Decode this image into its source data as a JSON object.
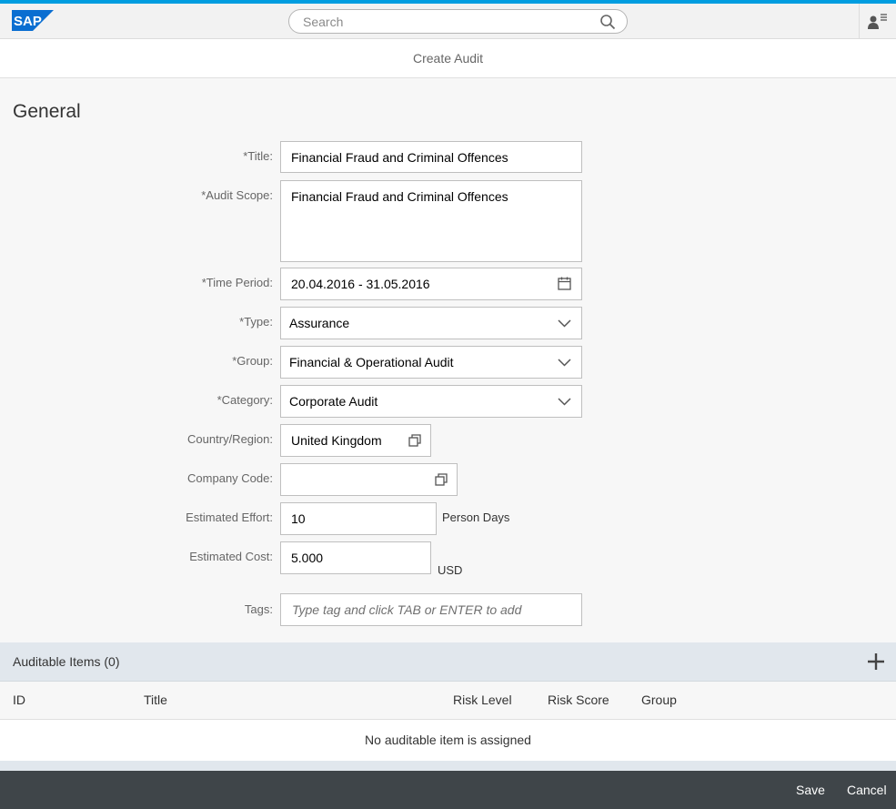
{
  "colors": {
    "brand": "#009de0",
    "footer": "#3f4549",
    "items_header": "#e1e7ed"
  },
  "shell": {
    "logo_text": "SAP",
    "search_placeholder": "Search",
    "search_icon": "search-icon",
    "user_icon": "user-menu-icon"
  },
  "page": {
    "title": "Create Audit"
  },
  "general": {
    "section_title": "General",
    "title": {
      "label": "*Title:",
      "value": "Financial Fraud and Criminal Offences"
    },
    "audit_scope": {
      "label": "*Audit Scope:",
      "value": "Financial Fraud and Criminal Offences"
    },
    "time_period": {
      "label": "*Time Period:",
      "value": "20.04.2016 - 31.05.2016",
      "icon": "calendar-icon"
    },
    "type": {
      "label": "*Type:",
      "value": "Assurance",
      "icon": "chevron-down-icon"
    },
    "group": {
      "label": "*Group:",
      "value": "Financial & Operational Audit",
      "icon": "chevron-down-icon"
    },
    "category": {
      "label": "*Category:",
      "value": "Corporate Audit",
      "icon": "chevron-down-icon"
    },
    "country": {
      "label": "Country/Region:",
      "value": "United Kingdom",
      "icon": "value-help-icon"
    },
    "company_code": {
      "label": "Company Code:",
      "value": "",
      "icon": "value-help-icon"
    },
    "effort": {
      "label": "Estimated Effort:",
      "value": "10",
      "unit": "Person Days"
    },
    "cost": {
      "label": "Estimated Cost:",
      "value": "5.000",
      "unit": "USD"
    },
    "tags": {
      "label": "Tags:",
      "placeholder": "Type tag and click TAB or ENTER to add"
    }
  },
  "items": {
    "title": "Auditable Items (0)",
    "columns": [
      "ID",
      "Title",
      "Risk Level",
      "Risk Score",
      "Group"
    ],
    "empty_text": "No auditable item is assigned",
    "add_icon": "add-icon"
  },
  "footer": {
    "save_label": "Save",
    "cancel_label": "Cancel"
  }
}
